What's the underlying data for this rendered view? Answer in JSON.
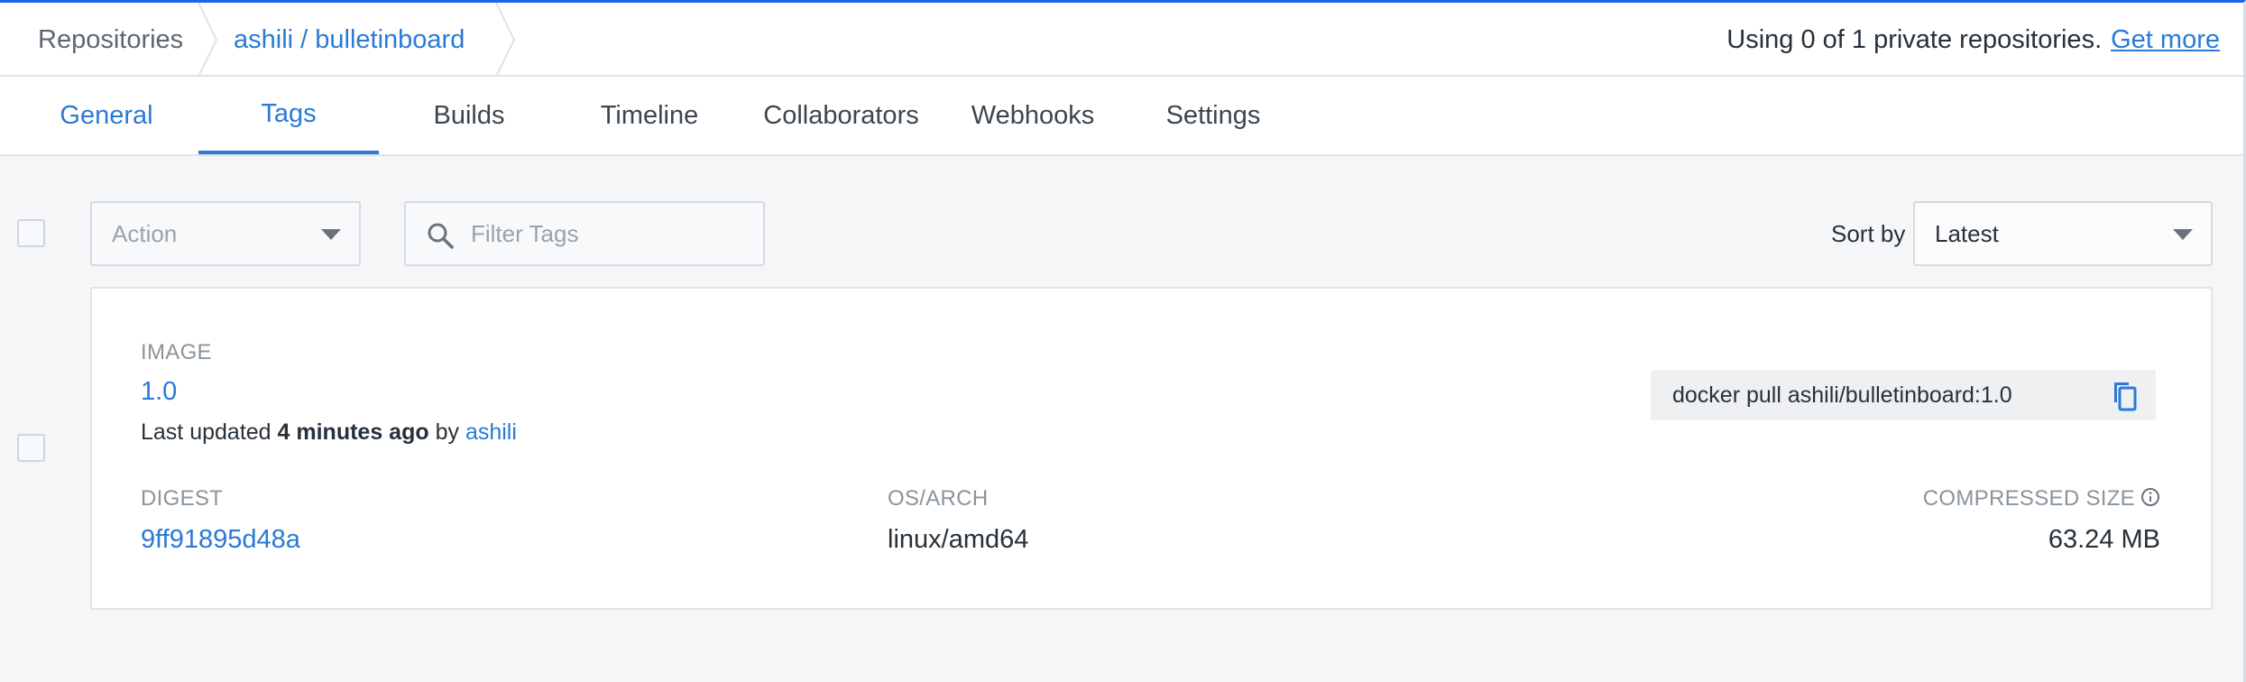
{
  "breadcrumb": {
    "root": "Repositories",
    "repo": "ashili / bulletinboard"
  },
  "private_notice": {
    "text": "Using 0 of 1 private repositories.",
    "link": "Get more"
  },
  "tabs": [
    {
      "label": "General"
    },
    {
      "label": "Tags",
      "active": true
    },
    {
      "label": "Builds"
    },
    {
      "label": "Timeline"
    },
    {
      "label": "Collaborators"
    },
    {
      "label": "Webhooks"
    },
    {
      "label": "Settings"
    }
  ],
  "toolbar": {
    "action_placeholder": "Action",
    "filter_placeholder": "Filter Tags",
    "sort_label": "Sort by",
    "sort_value": "Latest"
  },
  "tag_card": {
    "image_label": "IMAGE",
    "tag": "1.0",
    "updated_prefix": "Last updated",
    "updated_time": "4 minutes ago",
    "updated_by_word": "by",
    "updated_user": "ashili",
    "pull_command": "docker pull ashili/bulletinboard:1.0",
    "digest_label": "DIGEST",
    "digest": "9ff91895d48a",
    "os_arch_label": "OS/ARCH",
    "os_arch": "linux/amd64",
    "size_label": "COMPRESSED SIZE",
    "size": "63.24 MB"
  },
  "colors": {
    "accent": "#2a7ad6",
    "top_border": "#1d63ed",
    "background": "#f5f6f8"
  }
}
